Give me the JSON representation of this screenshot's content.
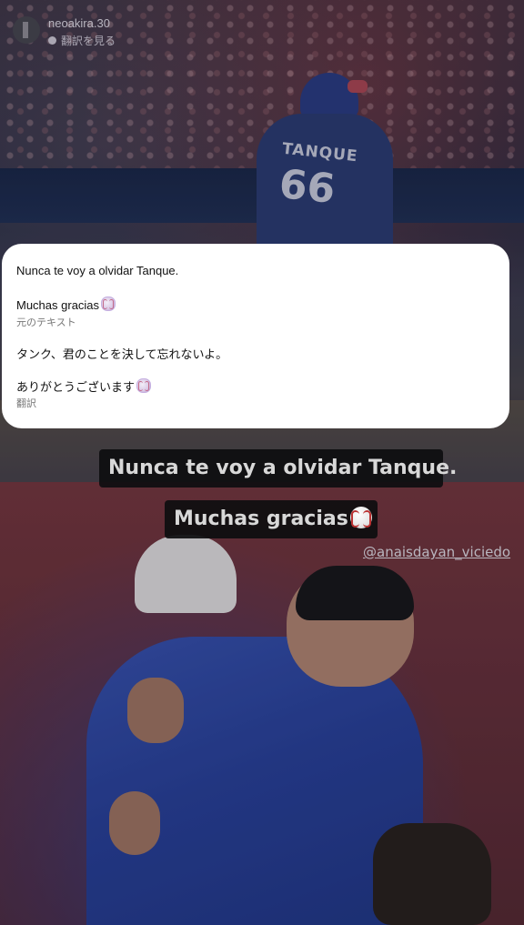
{
  "header": {
    "username": "neoakira.30",
    "see_translation": "翻訳を見る"
  },
  "translation_card": {
    "original_line1": "Nunca te voy a olvidar Tanque.",
    "original_line2": "Muchas gracias",
    "original_label": "元のテキスト",
    "translated_line1": "タンク、君のことを決して忘れないよ。",
    "translated_line2": "ありがとうございます",
    "translated_label": "翻訳"
  },
  "captions": {
    "line1": "Nunca te voy a olvidar Tanque.",
    "line2": "Muchas gracias"
  },
  "mention": "@anaisdayan_viciedo",
  "photo": {
    "jersey_name": "TANQUE",
    "jersey_number": "66"
  },
  "icons": {
    "baseball": "baseball-icon",
    "translate": "translate-icon"
  }
}
